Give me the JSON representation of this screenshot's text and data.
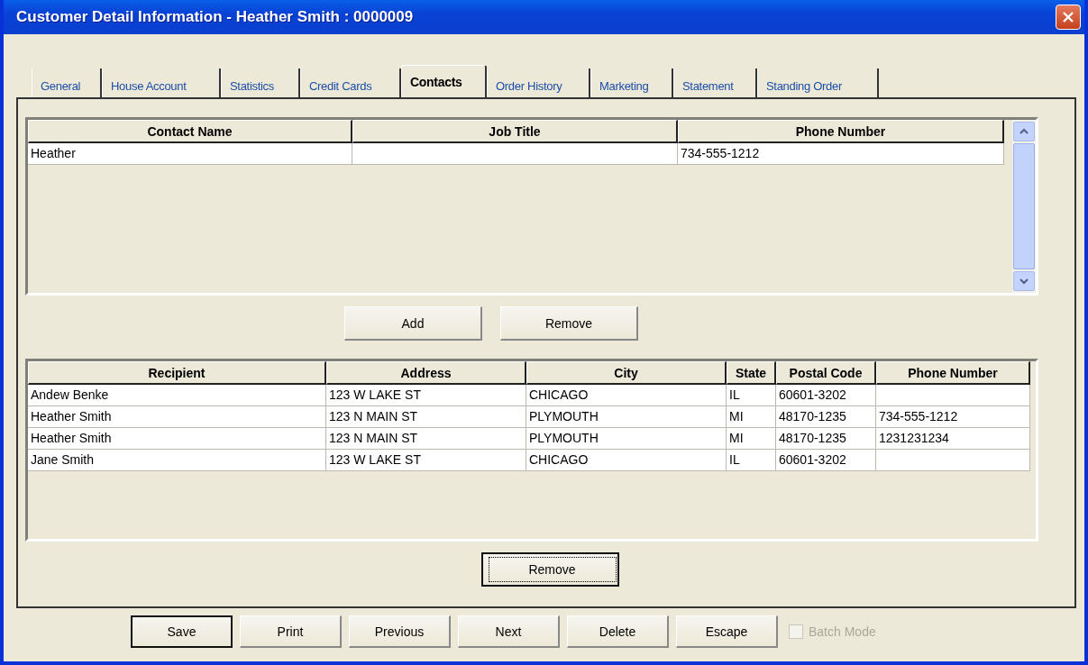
{
  "window": {
    "title": "Customer Detail Information - Heather Smith : 0000009"
  },
  "tabs": [
    {
      "label": "General",
      "selected": false
    },
    {
      "label": "House Account",
      "selected": false
    },
    {
      "label": "Statistics",
      "selected": false
    },
    {
      "label": "Credit Cards",
      "selected": false
    },
    {
      "label": "Contacts",
      "selected": true
    },
    {
      "label": "Order History",
      "selected": false
    },
    {
      "label": "Marketing",
      "selected": false
    },
    {
      "label": "Statement",
      "selected": false
    },
    {
      "label": "Standing Order",
      "selected": false
    }
  ],
  "contacts": {
    "columns": [
      "Contact Name",
      "Job Title",
      "Phone Number"
    ],
    "rows": [
      [
        "Heather",
        "",
        "734-555-1212"
      ]
    ]
  },
  "contact_buttons": [
    {
      "label": "Add",
      "focused": false
    },
    {
      "label": "Remove",
      "focused": false
    }
  ],
  "recipients": {
    "columns": [
      "Recipient",
      "Address",
      "City",
      "State",
      "Postal Code",
      "Phone Number"
    ],
    "rows": [
      [
        "Andew Benke",
        "123 W LAKE ST",
        "CHICAGO",
        "IL",
        "60601-3202",
        ""
      ],
      [
        "Heather Smith",
        "123 N MAIN ST",
        "PLYMOUTH",
        "MI",
        "48170-1235",
        "734-555-1212"
      ],
      [
        "Heather Smith",
        "123 N MAIN ST",
        "PLYMOUTH",
        "MI",
        "48170-1235",
        "1231231234"
      ],
      [
        "Jane Smith",
        "123 W LAKE ST",
        "CHICAGO",
        "IL",
        "60601-3202",
        ""
      ]
    ]
  },
  "recipient_buttons": [
    {
      "label": "Remove",
      "focused": true
    }
  ],
  "footer_buttons": [
    {
      "label": "Save",
      "default": true
    },
    {
      "label": "Print",
      "default": false
    },
    {
      "label": "Previous",
      "default": false
    },
    {
      "label": "Next",
      "default": false
    },
    {
      "label": "Delete",
      "default": false
    },
    {
      "label": "Escape",
      "default": false
    }
  ],
  "batch_mode": {
    "label": "Batch Mode",
    "checked": false,
    "disabled": true
  }
}
